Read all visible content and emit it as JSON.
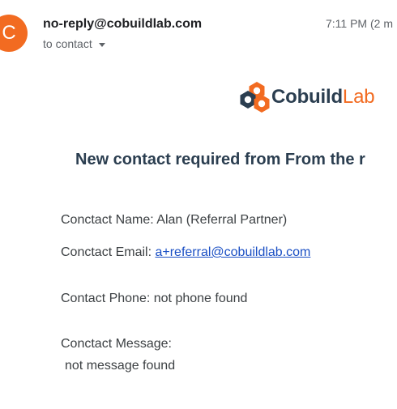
{
  "header": {
    "avatar_letter": "C",
    "avatar_color": "#f26b21",
    "sender": "no-reply@cobuildlab.com",
    "recipient": "to contact",
    "time": "7:11 PM (2 m"
  },
  "logo": {
    "word1": "Cobuild",
    "word2": "Lab",
    "dark_color": "#2b3e50",
    "accent_color": "#f26b21"
  },
  "body": {
    "heading": "New contact required from From the r",
    "name_label": "Conctact Name: ",
    "name_value": "Alan (Referral Partner)",
    "email_label": "Conctact Email: ",
    "email_value": "a+referral@cobuildlab.com",
    "phone_label": "Contact Phone: ",
    "phone_value": "not phone found",
    "message_label": "Conctact Message:",
    "message_value": "not message found"
  }
}
